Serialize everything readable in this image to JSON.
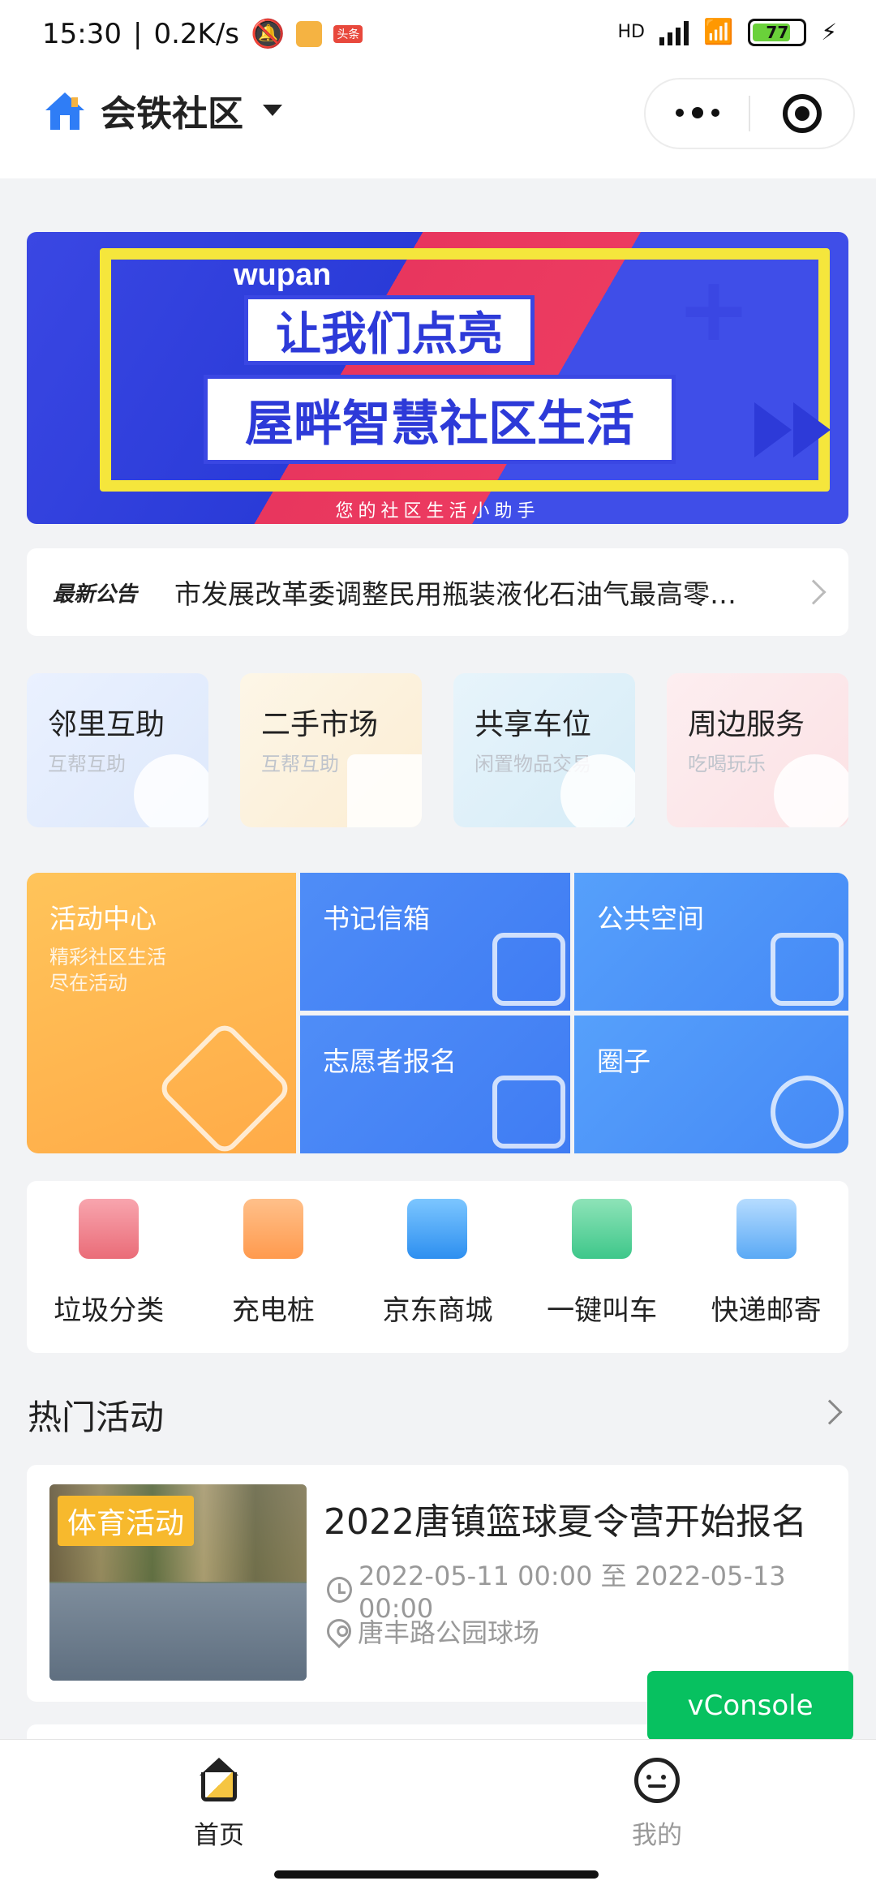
{
  "status_bar": {
    "time": "15:30",
    "speed": "0.2K/s",
    "news_badge": "头条",
    "hd": "HD",
    "battery": "77"
  },
  "header": {
    "title": "会铁社区"
  },
  "banner": {
    "brand": "wupan",
    "line1": "让我们点亮",
    "line2": "屋畔智慧社区生活",
    "tagline": "您的社区生活小助手"
  },
  "notice": {
    "label": "最新公告",
    "text": "市发展改革委调整民用瓶装液化石油气最高零…"
  },
  "services": [
    {
      "title": "邻里互助",
      "subtitle": "互帮互助"
    },
    {
      "title": "二手市场",
      "subtitle": "互帮互助"
    },
    {
      "title": "共享车位",
      "subtitle": "闲置物品交易"
    },
    {
      "title": "周边服务",
      "subtitle": "吃喝玩乐"
    }
  ],
  "tiles": {
    "activity_center": {
      "title": "活动中心",
      "sub1": "精彩社区生活",
      "sub2": "尽在活动"
    },
    "mailbox": {
      "title": "书记信箱"
    },
    "public_space": {
      "title": "公共空间"
    },
    "volunteer": {
      "title": "志愿者报名"
    },
    "circle": {
      "title": "圈子"
    }
  },
  "quick": [
    {
      "label": "垃圾分类",
      "icon": "trash-icon"
    },
    {
      "label": "充电桩",
      "icon": "charger-icon"
    },
    {
      "label": "京东商城",
      "icon": "shop-box-icon"
    },
    {
      "label": "一键叫车",
      "icon": "car-icon"
    },
    {
      "label": "快递邮寄",
      "icon": "mail-icon"
    }
  ],
  "hot": {
    "title": "热门活动",
    "card": {
      "tag": "体育活动",
      "title": "2022唐镇篮球夏令营开始报名",
      "time": "2022-05-11 00:00 至 2022-05-13 00:00",
      "location": "唐丰路公园球场"
    }
  },
  "vconsole": "vConsole",
  "tabbar": {
    "home": "首页",
    "me": "我的"
  },
  "colors": {
    "accent_orange": "#f7b92d",
    "tile_blue": "#4589f6",
    "vconsole_green": "#07c160"
  }
}
